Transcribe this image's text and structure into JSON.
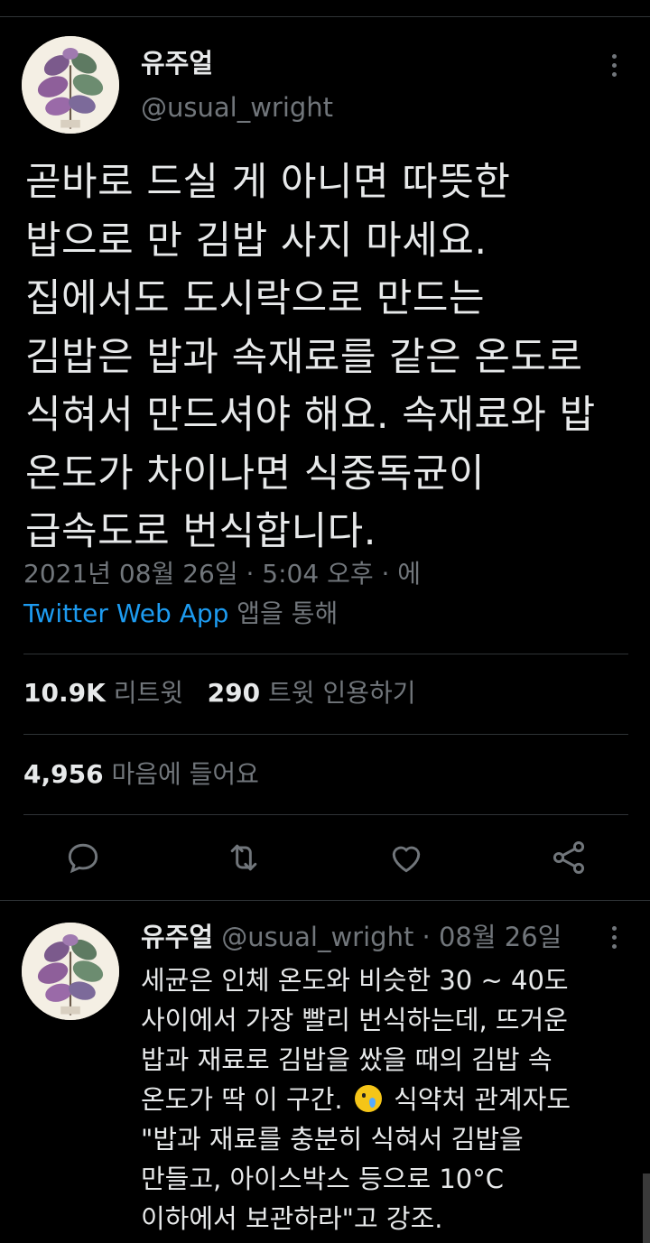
{
  "tweet": {
    "author": {
      "display_name": "유주얼",
      "handle": "@usual_wright"
    },
    "body_lines": [
      "곧바로 드실 게 아니면 따뜻한",
      "밥으로 만 김밥 사지 마세요.",
      "집에서도 도시락으로 만드는",
      "김밥은 밥과 속재료를 같은 온도로",
      "식혀서 만드셔야 해요. 속재료와 밥",
      "온도가 차이나면 식중독균이",
      "급속도로 번식합니다."
    ],
    "timestamp": "2021년 08월 26일 · 5:04 오후 · 에",
    "source": {
      "app": "Twitter Web App",
      "suffix": " 앱을 통해"
    },
    "stats": {
      "retweets_count": "10.9K",
      "retweets_label": "리트윗",
      "quotes_count": "290",
      "quotes_label": "트윗 인용하기",
      "likes_count": "4,956",
      "likes_label": "마음에 들어요"
    },
    "actions": [
      "reply-icon",
      "retweet-icon",
      "like-icon",
      "share-icon"
    ]
  },
  "reply": {
    "display_name": "유주얼",
    "handle": "@usual_wright",
    "date": " · 08월 26일",
    "line1": "세균은 인체 온도와 비슷한 30 ~ 40도",
    "line2": "사이에서 가장 빨리 번식하는데, 뜨거운",
    "line3": "밥과 재료로 김밥을 쌌을 때의 김밥 속",
    "line4_before": "온도가 딱 이 구간. ",
    "line4_emoji": "crying-face-emoji",
    "line4_after": " 식약처 관계자도",
    "line5": "\"밥과 재료를 충분히 식혀서 김밥을",
    "line6": "만들고, 아이스박스 등으로 10°C",
    "line7": "이하에서 보관하라\"고 강조."
  },
  "colors": {
    "background": "#000000",
    "text": "#e7e9ea",
    "secondary": "#71767b",
    "link": "#1d9bf0",
    "divider": "#2f3336"
  }
}
